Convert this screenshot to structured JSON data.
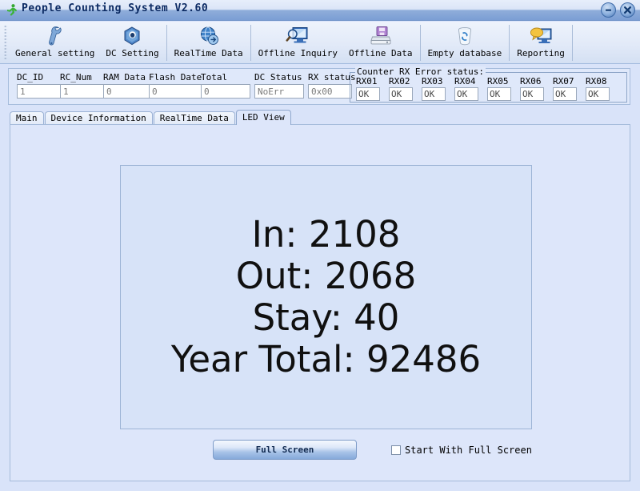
{
  "window": {
    "title": "People Counting System  V2.60",
    "icon": "runner-icon",
    "minimize_label": "–",
    "close_label": "✕"
  },
  "toolbar": {
    "items": [
      {
        "label": "General setting",
        "icon": "wrench-icon"
      },
      {
        "label": "DC Setting",
        "icon": "nut-icon"
      },
      {
        "label": "RealTime Data",
        "icon": "globe-icon"
      },
      {
        "label": "Offline Inquiry",
        "icon": "magnifier-monitor-icon"
      },
      {
        "label": "Offline Data",
        "icon": "floppy-drive-icon"
      },
      {
        "label": "Empty database",
        "icon": "trash-bin-icon"
      },
      {
        "label": "Reporting",
        "icon": "report-monitor-icon"
      }
    ]
  },
  "status": {
    "fields": [
      {
        "label": "DC_ID",
        "value": "1"
      },
      {
        "label": "RC_Num",
        "value": "1"
      },
      {
        "label": "RAM Data",
        "value": "0"
      },
      {
        "label": "Flash Date",
        "value": "0"
      },
      {
        "label": "Total",
        "value": "0"
      },
      {
        "label": "DC Status",
        "value": "NoErr"
      },
      {
        "label": "RX status",
        "value": "0x00"
      }
    ],
    "rx_group_title": "Counter RX Error status:",
    "rx_channels": [
      {
        "label": "RX01",
        "value": "OK"
      },
      {
        "label": "RX02",
        "value": "OK"
      },
      {
        "label": "RX03",
        "value": "OK"
      },
      {
        "label": "RX04",
        "value": "OK"
      },
      {
        "label": "RX05",
        "value": "OK"
      },
      {
        "label": "RX06",
        "value": "OK"
      },
      {
        "label": "RX07",
        "value": "OK"
      },
      {
        "label": "RX08",
        "value": "OK"
      }
    ]
  },
  "tabs": [
    {
      "label": "Main",
      "active": false
    },
    {
      "label": "Device Information",
      "active": false
    },
    {
      "label": "RealTime Data",
      "active": false
    },
    {
      "label": "LED View",
      "active": true
    }
  ],
  "led_view": {
    "lines": [
      {
        "label": "In:",
        "value": "2108",
        "text": "In: 2108"
      },
      {
        "label": "Out:",
        "value": "2068",
        "text": "Out: 2068"
      },
      {
        "label": "Stay:",
        "value": "40",
        "text": "Stay: 40"
      },
      {
        "label": "Year Total:",
        "value": "92486",
        "text": "Year Total: 92486"
      }
    ],
    "full_screen_button": "Full Screen",
    "start_full_screen_label": "Start With Full Screen",
    "start_full_screen_checked": false
  },
  "colors": {
    "window_bg": "#d9e3f9",
    "panel_bg": "#dde6fa",
    "led_bg": "#d7e3f8",
    "titlebar_blue": "#7b9ed4",
    "accent_border": "#a4bada"
  }
}
